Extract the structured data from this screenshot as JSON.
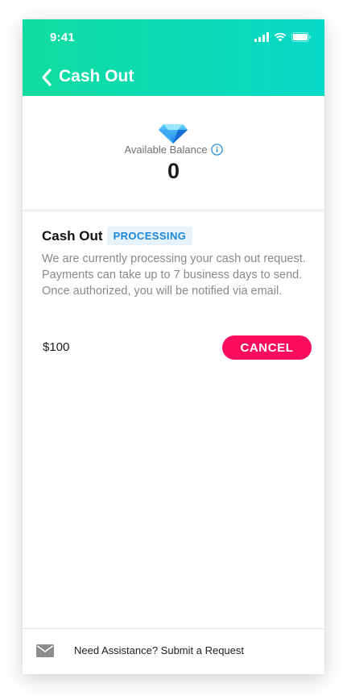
{
  "status_bar": {
    "time": "9:41"
  },
  "nav": {
    "title": "Cash Out",
    "back_icon": "chevron-left-icon"
  },
  "balance": {
    "label": "Available Balance",
    "value": "0",
    "icon": "diamond-icon"
  },
  "cashout": {
    "title": "Cash Out",
    "status": "PROCESSING",
    "description": "We are currently processing your cash out request. Payments can take up to 7 business days to send. Once authorized, you will be notified via email.",
    "amount": "$100",
    "cancel_label": "CANCEL"
  },
  "footer": {
    "text": "Need Assistance? Submit a Request",
    "icon": "mail-icon"
  },
  "colors": {
    "header_gradient_start": "#11dca0",
    "header_gradient_end": "#07d9c8",
    "badge_text": "#1b88dc",
    "badge_bg": "#e6f3fd",
    "cancel_button": "#fb0d5e"
  }
}
